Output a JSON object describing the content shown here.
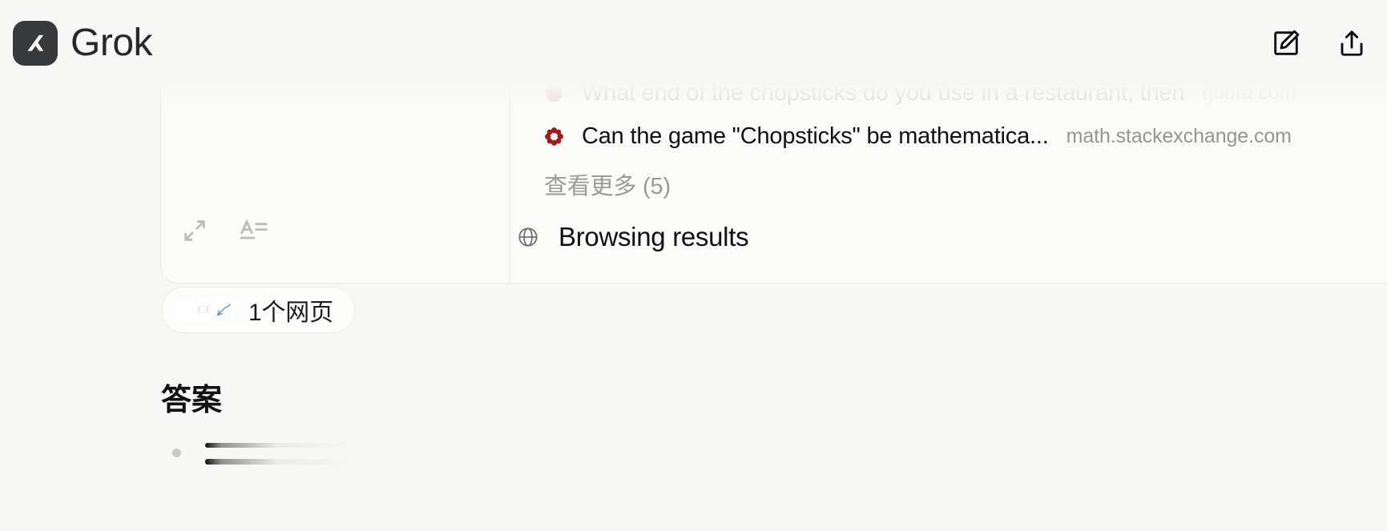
{
  "app": {
    "brand": "Grok",
    "logo_icon": "xai-logo-icon",
    "background_color": "#f7f7f5"
  },
  "topbar": {
    "compose_icon": "compose-pencil-square-icon",
    "share_icon": "share-upload-icon"
  },
  "sources_card": {
    "tools": {
      "expand_icon": "expand-arrows-icon",
      "text_format_icon": "text-format-icon"
    },
    "rows": [
      {
        "favicon": "quora-favicon",
        "title": "What end of the chopsticks do you use in a restaurant, then",
        "domain": "quora.com",
        "faded": true
      },
      {
        "favicon": "math-stackexchange-favicon",
        "title": "Can the game \"Chopsticks\" be mathematica...",
        "domain": "math.stackexchange.com",
        "faded": false
      }
    ],
    "view_more_label": "查看更多 (5)",
    "browsing": {
      "icon": "globe-icon",
      "label": "Browsing results"
    }
  },
  "webpages_pill": {
    "label": "1个网页",
    "avatars": [
      {
        "name": "earth-favicon",
        "text": ""
      },
      {
        "name": "cc-favicon",
        "text": "CC"
      },
      {
        "name": "blue-glyph-favicon",
        "text": ""
      }
    ]
  },
  "answer": {
    "heading": "答案"
  },
  "colors": {
    "accent_red": "#a61f25",
    "text_primary": "#0f1113",
    "text_muted": "#96958f",
    "card_bg": "#fbfbf9",
    "card_border": "#eceae4"
  }
}
